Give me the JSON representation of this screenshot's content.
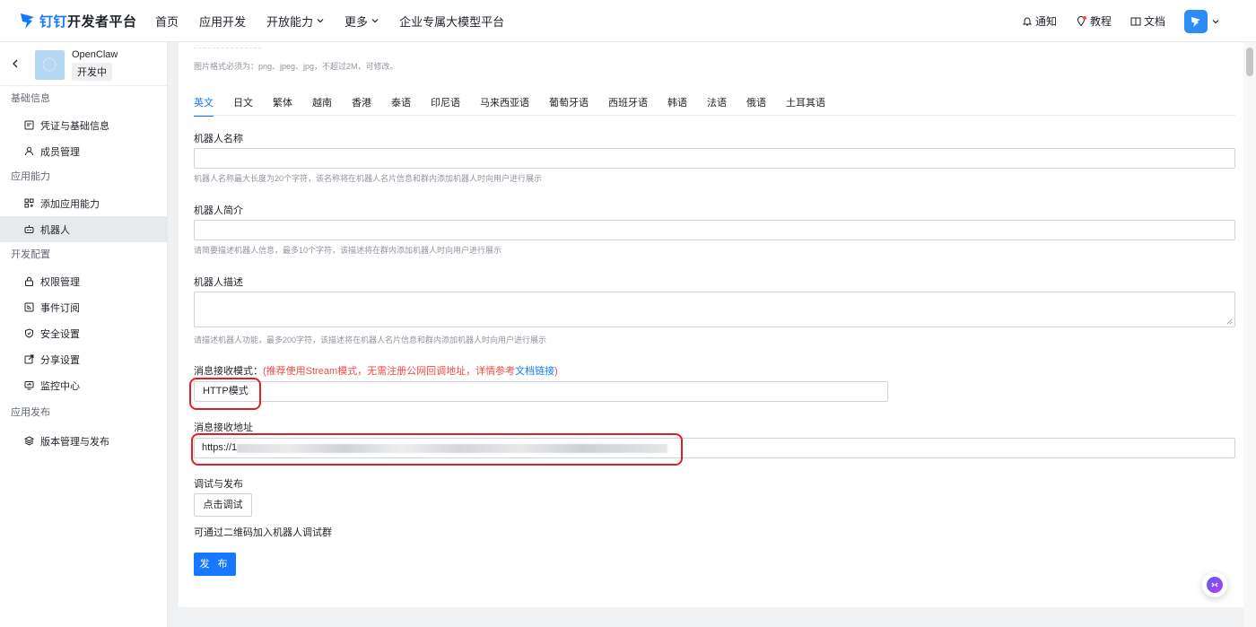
{
  "header": {
    "logo_brand": "钉钉",
    "logo_text": "开发者平台",
    "nav": [
      {
        "label": "首页",
        "dropdown": false
      },
      {
        "label": "应用开发",
        "dropdown": false
      },
      {
        "label": "开放能力",
        "dropdown": true
      },
      {
        "label": "更多",
        "dropdown": true
      },
      {
        "label": "企业专属大模型平台",
        "dropdown": false
      }
    ],
    "notify": "通知",
    "tutorial": "教程",
    "docs": "文档"
  },
  "sidebar": {
    "app_name": "OpenClaw",
    "app_status": "开发中",
    "groups": [
      {
        "title": "基础信息",
        "items": [
          {
            "label": "凭证与基础信息",
            "icon": "credential-icon"
          },
          {
            "label": "成员管理",
            "icon": "member-icon"
          }
        ]
      },
      {
        "title": "应用能力",
        "items": [
          {
            "label": "添加应用能力",
            "icon": "add-capability-icon"
          },
          {
            "label": "机器人",
            "icon": "robot-icon",
            "active": true
          }
        ]
      },
      {
        "title": "开发配置",
        "items": [
          {
            "label": "权限管理",
            "icon": "lock-icon"
          },
          {
            "label": "事件订阅",
            "icon": "event-icon"
          },
          {
            "label": "安全设置",
            "icon": "shield-icon"
          },
          {
            "label": "分享设置",
            "icon": "share-icon"
          },
          {
            "label": "监控中心",
            "icon": "monitor-icon"
          }
        ]
      },
      {
        "title": "应用发布",
        "items": [
          {
            "label": "版本管理与发布",
            "icon": "layers-icon"
          }
        ]
      }
    ]
  },
  "main": {
    "image_hint": "图片格式必须为：png、jpeg、jpg，不超过2M，可修改。",
    "tabs": [
      "英文",
      "日文",
      "繁体",
      "越南",
      "香港",
      "泰语",
      "印尼语",
      "马来西亚语",
      "葡萄牙语",
      "西班牙语",
      "韩语",
      "法语",
      "俄语",
      "土耳其语"
    ],
    "active_tab": "英文",
    "robot_name": {
      "label": "机器人名称",
      "value": "",
      "hint": "机器人名称最大长度为20个字符，该名称将在机器人名片信息和群内添加机器人时向用户进行展示"
    },
    "robot_intro": {
      "label": "机器人简介",
      "value": "",
      "hint": "请简要描述机器人信息，最多10个字符，该描述将在群内添加机器人时向用户进行展示"
    },
    "robot_desc": {
      "label": "机器人描述",
      "value": "",
      "hint": "请描述机器人功能，最多200字符，该描述将在机器人名片信息和群内添加机器人时向用户进行展示"
    },
    "msg_mode": {
      "label": "消息接收模式：",
      "note": "(推荐使用Stream模式，无需注册公网回调地址，详情参考",
      "link": "文档链接",
      "close": ")",
      "value": "HTTP模式"
    },
    "msg_url": {
      "label": "消息接收地址",
      "value": "https://1"
    },
    "debug": {
      "label": "调试与发布",
      "button": "点击调试",
      "qr_hint": "可通过二维码加入机器人调试群"
    },
    "publish_button": "发 布"
  },
  "colors": {
    "accent": "#1677ff",
    "warn": "#f54a45",
    "highlight_ring": "#e02020"
  }
}
